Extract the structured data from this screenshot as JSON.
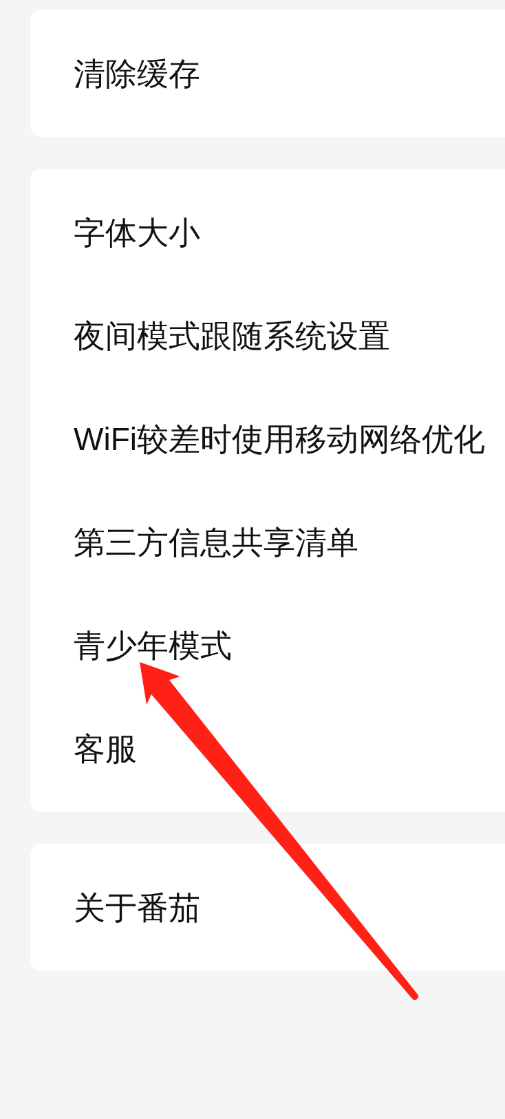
{
  "sections": [
    {
      "items": [
        {
          "label": "清除缓存"
        }
      ]
    },
    {
      "items": [
        {
          "label": "字体大小"
        },
        {
          "label": "夜间模式跟随系统设置"
        },
        {
          "label": "WiFi较差时使用移动网络优化"
        },
        {
          "label": "第三方信息共享清单"
        },
        {
          "label": "青少年模式"
        },
        {
          "label": "客服"
        }
      ]
    },
    {
      "items": [
        {
          "label": "关于番茄"
        }
      ]
    }
  ]
}
